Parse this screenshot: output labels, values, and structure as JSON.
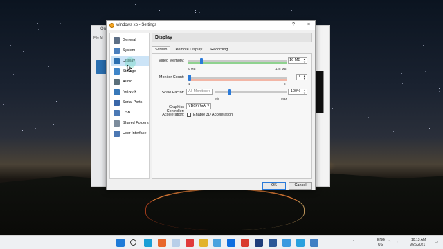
{
  "window": {
    "title": "windows xp - Settings",
    "help_glyph": "?",
    "close_glyph": "×"
  },
  "background_manager": {
    "label": "Ora",
    "menu": "File  M"
  },
  "sidebar": {
    "items": [
      {
        "label": "General",
        "icon": "general-icon",
        "color": "#5d6f86"
      },
      {
        "label": "System",
        "icon": "system-icon",
        "color": "#4a7fbd"
      },
      {
        "label": "Display",
        "icon": "display-icon",
        "color": "#2a6fb0"
      },
      {
        "label": "Storage",
        "icon": "storage-icon",
        "color": "#3f86c9"
      },
      {
        "label": "Audio",
        "icon": "audio-icon",
        "color": "#5b6f7a"
      },
      {
        "label": "Network",
        "icon": "network-icon",
        "color": "#3878b8"
      },
      {
        "label": "Serial Ports",
        "icon": "serial-ports-icon",
        "color": "#3a67a8"
      },
      {
        "label": "USB",
        "icon": "usb-icon",
        "color": "#4b79b5"
      },
      {
        "label": "Shared Folders",
        "icon": "shared-folders-icon",
        "color": "#7c8c9c"
      },
      {
        "label": "User Interface",
        "icon": "user-interface-icon",
        "color": "#4c78b3"
      }
    ],
    "selected_index": 2
  },
  "content": {
    "header": "Display",
    "tabs": [
      "Screen",
      "Remote Display",
      "Recording"
    ],
    "active_tab": 0,
    "video_memory": {
      "label": "Video Memory:",
      "value": "16 MB",
      "min_label": "0 MB",
      "max_label": "128 MB",
      "fraction": 0.125
    },
    "monitor_count": {
      "label": "Monitor Count:",
      "value": "1",
      "min_label": "1",
      "max_label": "8",
      "fraction": 0.0
    },
    "scale_factor": {
      "label": "Scale Factor:",
      "select_value": "All Monitors",
      "value": "100%",
      "min_label": "Min",
      "max_label": "Max",
      "fraction": 0.2
    },
    "graphics_controller": {
      "label": "Graphics Controller:",
      "value": "VBoxVGA"
    },
    "acceleration": {
      "label": "Acceleration:",
      "checkbox_label": "Enable 3D Acceleration",
      "checked": false
    }
  },
  "buttons": {
    "ok": "OK",
    "cancel": "Cancel"
  },
  "taskbar": {
    "apps": [
      "windows-start-icon",
      "search-icon",
      "edge-icon",
      "firefox-icon",
      "photos-icon",
      "vivaldi-icon",
      "chrome-icon",
      "notepad-icon",
      "teamviewer-icon",
      "wps-icon",
      "photoshop-icon",
      "word-icon",
      "download-icon",
      "telegram-icon",
      "virtualbox-icon"
    ],
    "language": "ENG",
    "region": "US",
    "time": "10:13 AM",
    "date": "9/26/2021"
  },
  "colors": {
    "accent": "#2a7ad9",
    "selection": "#cce4f7",
    "ok_zone": "#8fd28f",
    "warn_zone": "#f2b6a6"
  }
}
